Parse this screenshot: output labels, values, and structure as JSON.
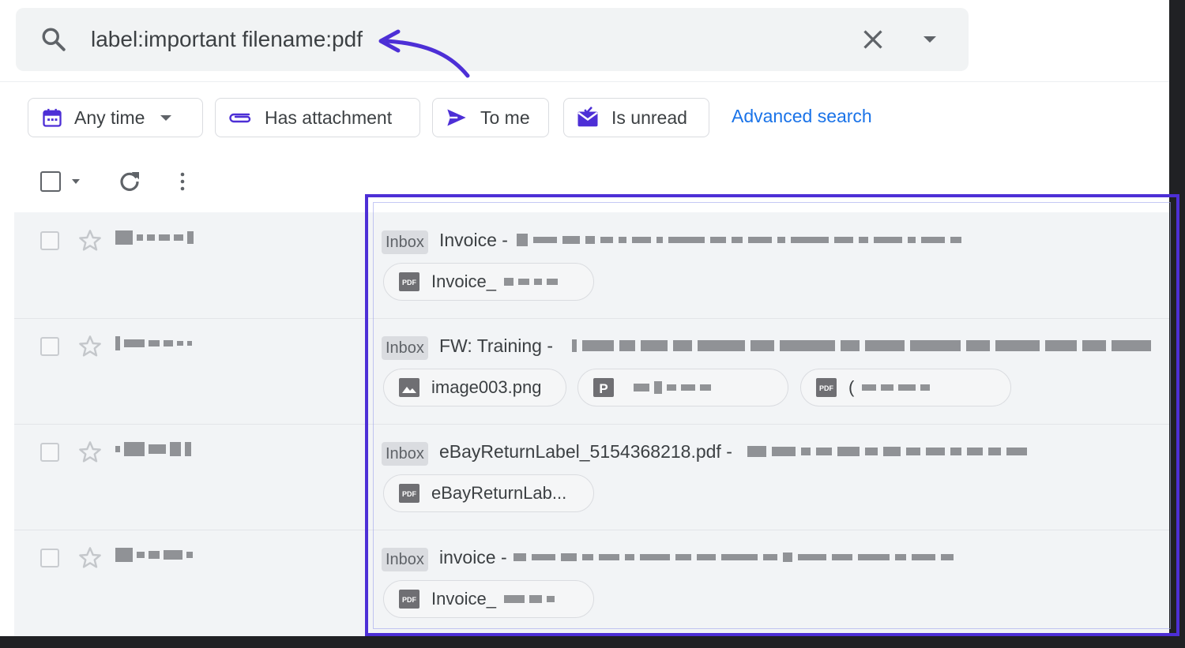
{
  "search": {
    "query": "label:important filename:pdf"
  },
  "filters": {
    "any_time": "Any time",
    "has_attachment": "Has attachment",
    "to_me": "To me",
    "is_unread": "Is unread",
    "advanced_search": "Advanced search"
  },
  "messages": [
    {
      "label": "Inbox",
      "subject": "Invoice -",
      "attachments": [
        {
          "type": "pdf",
          "name": "Invoice_"
        }
      ]
    },
    {
      "label": "Inbox",
      "subject": "FW: Training -",
      "attachments": [
        {
          "type": "image",
          "name": "image003.png"
        },
        {
          "type": "p",
          "name": ""
        },
        {
          "type": "pdf",
          "name": "("
        }
      ]
    },
    {
      "label": "Inbox",
      "subject": "eBayReturnLabel_5154368218.pdf -",
      "attachments": [
        {
          "type": "pdf",
          "name": "eBayReturnLab..."
        }
      ]
    },
    {
      "label": "Inbox",
      "subject": "invoice -",
      "attachments": [
        {
          "type": "pdf",
          "name": "Invoice_"
        }
      ]
    }
  ],
  "colors": {
    "accent": "#1a73e8",
    "highlight": "#4d2fd6",
    "annotation_arrow": "#4d2fd6",
    "list_bg": "#f2f4f6"
  },
  "icons": {
    "search": "search-icon",
    "clear": "close-icon",
    "options": "dropdown-icon",
    "calendar": "calendar-icon",
    "paperclip": "paperclip-icon",
    "send": "send-icon",
    "unread": "mail-unread-icon",
    "refresh": "refresh-icon",
    "more": "more-vert-icon",
    "star": "star-outline-icon"
  }
}
